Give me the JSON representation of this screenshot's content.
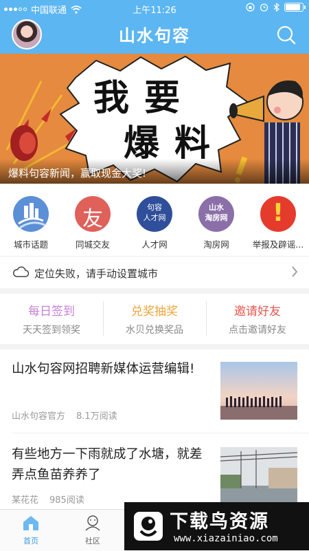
{
  "status_bar": {
    "carrier": "中国联通",
    "time": "上午11:26"
  },
  "header": {
    "title": "山水句容"
  },
  "banner": {
    "headline_line1": "我要",
    "headline_line2": "爆料",
    "caption": "爆料句容新闻，赢取现金大奖!"
  },
  "grid": [
    {
      "label": "城市话题",
      "icon": "city-topic-icon",
      "glyph": "",
      "color": "#5b8fd6"
    },
    {
      "label": "同城交友",
      "icon": "friend-icon",
      "glyph": "友",
      "color": "#e0605a"
    },
    {
      "label": "人才网",
      "icon": "talent-icon",
      "glyph": "句容\n人才网",
      "color": "#2f4f9a"
    },
    {
      "label": "淘房网",
      "icon": "house-icon",
      "glyph": "山水\n淘房网",
      "color": "#8a6fa8"
    },
    {
      "label": "举报及辟谣...",
      "icon": "report-icon",
      "glyph": "!",
      "color": "#e53b2c"
    }
  ],
  "location": {
    "text": "定位失败，请手动设置城市"
  },
  "actions": [
    {
      "title": "每日签到",
      "subtitle": "天天签到领奖",
      "color": "#c77fd8"
    },
    {
      "title": "兑奖抽奖",
      "subtitle": "水贝兑换奖品",
      "color": "#f0a43a"
    },
    {
      "title": "邀请好友",
      "subtitle": "点击邀请好友",
      "color": "#e8574f"
    }
  ],
  "news": [
    {
      "title": "山水句容网招聘新媒体运营编辑!",
      "author": "山水句容官方",
      "reads": "8.1万阅读"
    },
    {
      "title": "有些地方一下雨就成了水塘，就差弄点鱼苗养养了",
      "author": "某花花",
      "reads": "985阅读"
    }
  ],
  "tabs": [
    {
      "label": "首页",
      "icon": "home-icon",
      "active": true
    },
    {
      "label": "社区",
      "icon": "community-icon",
      "active": false
    }
  ],
  "watermark": {
    "title": "下载鸟资源",
    "url": "www.xiazainiao.com"
  },
  "colors": {
    "brand": "#5cb6f2",
    "active_tab": "#3a9ae6"
  }
}
